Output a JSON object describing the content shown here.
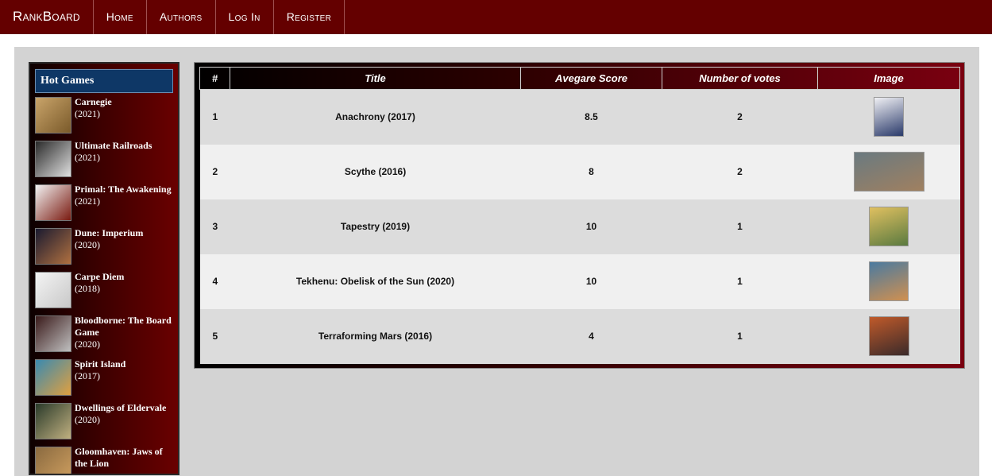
{
  "nav": {
    "brand": "RankBoard",
    "links": [
      "Home",
      "Authors",
      "Log In",
      "Register"
    ]
  },
  "sidebar": {
    "title": "Hot Games",
    "items": [
      {
        "name": "Carnegie",
        "year": "(2021)",
        "thumb_colors": [
          "#c9a46a",
          "#7a5a2a"
        ]
      },
      {
        "name": "Ultimate Railroads",
        "year": "(2021)",
        "thumb_colors": [
          "#2a2a2a",
          "#e0e0e0"
        ]
      },
      {
        "name": "Primal: The Awakening",
        "year": "(2021)",
        "thumb_colors": [
          "#f2f2f2",
          "#7a1a10"
        ]
      },
      {
        "name": "Dune: Imperium",
        "year": "(2020)",
        "thumb_colors": [
          "#1a1a30",
          "#b07040"
        ]
      },
      {
        "name": "Carpe Diem",
        "year": "(2018)",
        "thumb_colors": [
          "#f4f4f4",
          "#c8c8c8"
        ]
      },
      {
        "name": "Bloodborne: The Board Game",
        "year": "(2020)",
        "thumb_colors": [
          "#3a1a1a",
          "#c0c0c0"
        ]
      },
      {
        "name": "Spirit Island",
        "year": "(2017)",
        "thumb_colors": [
          "#3a8ab0",
          "#e0a040"
        ]
      },
      {
        "name": "Dwellings of Eldervale",
        "year": "(2020)",
        "thumb_colors": [
          "#2a3a2a",
          "#c0b080"
        ]
      },
      {
        "name": "Gloomhaven: Jaws of the Lion",
        "year": "",
        "thumb_colors": [
          "#8a6a40",
          "#d0a060"
        ]
      }
    ]
  },
  "table": {
    "headers": [
      "#",
      "Title",
      "Avegare Score",
      "Number of votes",
      "Image"
    ],
    "rows": [
      {
        "rank": "1",
        "title": "Anachrony (2017)",
        "score": "8.5",
        "votes": "2",
        "image": {
          "w": 38,
          "h": 50,
          "colors": [
            "#f0f0f4",
            "#2a3a6a"
          ]
        }
      },
      {
        "rank": "2",
        "title": "Scythe (2016)",
        "score": "8",
        "votes": "2",
        "image": {
          "w": 89,
          "h": 50,
          "colors": [
            "#6a7a80",
            "#a08060"
          ]
        }
      },
      {
        "rank": "3",
        "title": "Tapestry (2019)",
        "score": "10",
        "votes": "1",
        "image": {
          "w": 50,
          "h": 50,
          "colors": [
            "#e0c060",
            "#5a7a40"
          ]
        }
      },
      {
        "rank": "4",
        "title": "Tekhenu: Obelisk of the Sun (2020)",
        "score": "10",
        "votes": "1",
        "image": {
          "w": 50,
          "h": 50,
          "colors": [
            "#4a7aa0",
            "#d09050"
          ]
        }
      },
      {
        "rank": "5",
        "title": "Terraforming Mars (2016)",
        "score": "4",
        "votes": "1",
        "image": {
          "w": 51,
          "h": 50,
          "colors": [
            "#c05a2a",
            "#3a2a2a"
          ]
        }
      }
    ]
  }
}
